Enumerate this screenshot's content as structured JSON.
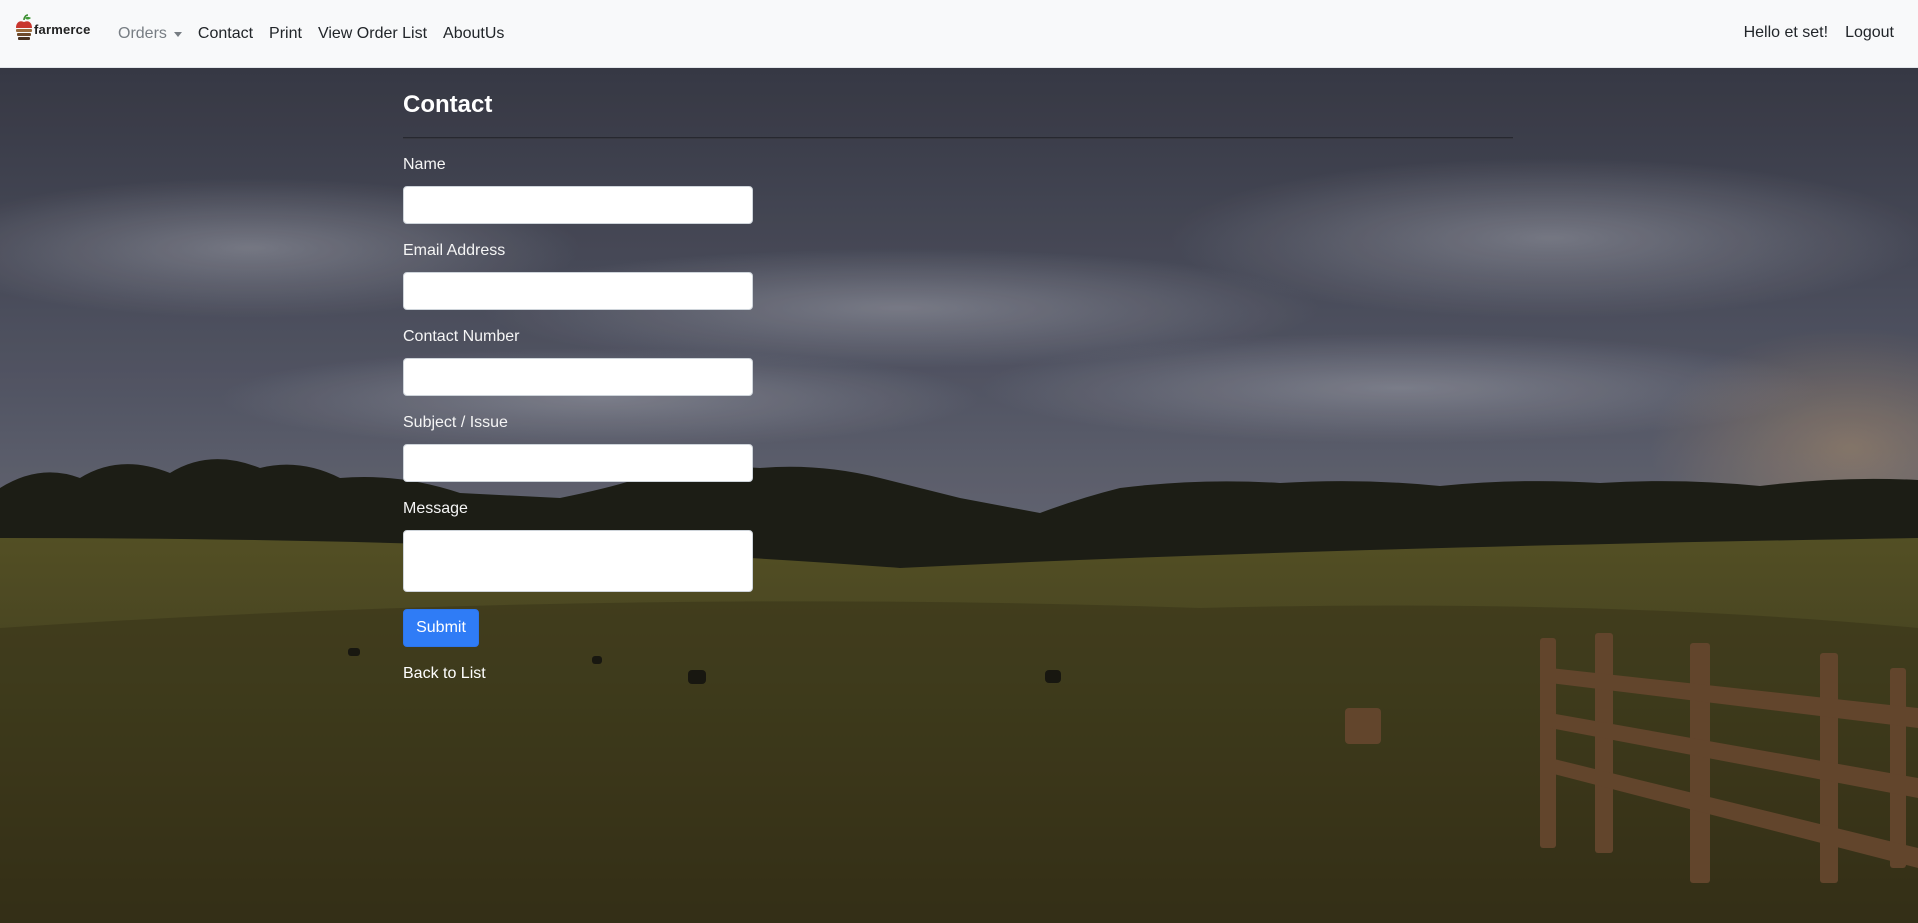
{
  "brand": {
    "name": "farmerce",
    "logo_icon": "apple-stack-logo-icon"
  },
  "nav": {
    "orders": "Orders",
    "contact": "Contact",
    "print": "Print",
    "view_order_list": "View Order List",
    "about_us": "AboutUs",
    "greeting": "Hello et set!",
    "logout": "Logout"
  },
  "form": {
    "title": "Contact",
    "fields": {
      "name": {
        "label": "Name",
        "value": ""
      },
      "email": {
        "label": "Email Address",
        "value": ""
      },
      "contact": {
        "label": "Contact Number",
        "value": ""
      },
      "subject": {
        "label": "Subject / Issue",
        "value": ""
      },
      "message": {
        "label": "Message",
        "value": ""
      }
    },
    "submit": "Submit",
    "back_link": "Back to List"
  },
  "colors": {
    "navbar_bg": "#f8f9fa",
    "primary_button": "#2f7cf6",
    "nav_text": "#212529",
    "nav_muted": "#777d83"
  }
}
